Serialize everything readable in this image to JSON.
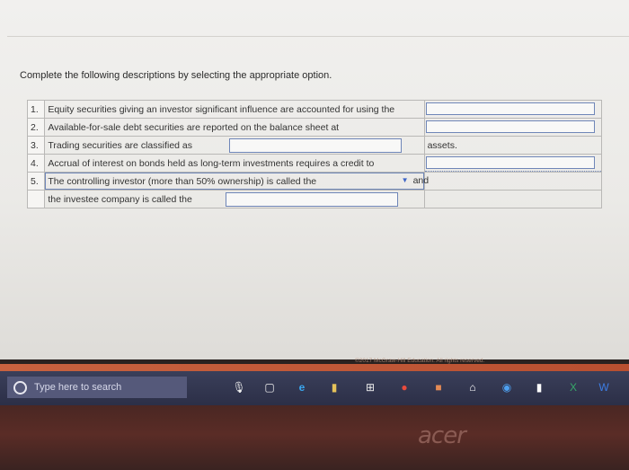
{
  "instructions": "Complete the following descriptions by selecting the appropriate option.",
  "questions": [
    {
      "num": "1.",
      "text": "Equity securities giving an investor significant influence are accounted for using the",
      "suffix": ""
    },
    {
      "num": "2.",
      "text": "Available-for-sale debt securities are reported on the balance sheet at",
      "suffix": ""
    },
    {
      "num": "3.",
      "text": "Trading securities are classified as",
      "suffix": "assets."
    },
    {
      "num": "4.",
      "text": "Accrual of interest on bonds held as long-term investments requires a credit to",
      "suffix": ""
    },
    {
      "num": "5.",
      "text": "The controlling investor (more than 50% ownership) is called the",
      "suffix": "and"
    },
    {
      "num": "",
      "text": "the investee company is called the",
      "suffix": ""
    }
  ],
  "copyright": "©2017 McGraw-Hill Education. All rights reserved.",
  "taskbar": {
    "search_placeholder": "Type here to search",
    "icons": [
      "microphone-icon",
      "task-view-icon",
      "edge-icon",
      "store-icon",
      "windows-store-icon",
      "chrome-icon",
      "app-icon",
      "home-icon",
      "media-icon",
      "app-icon-2",
      "excel-icon",
      "word-icon"
    ]
  },
  "brand": "acer"
}
